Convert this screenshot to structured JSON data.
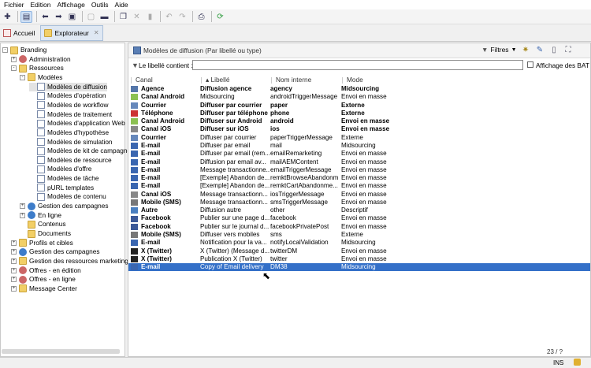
{
  "menu": [
    "Fichier",
    "Edition",
    "Affichage",
    "Outils",
    "Aide"
  ],
  "tabs": [
    {
      "label": "Accueil"
    },
    {
      "label": "Explorateur"
    }
  ],
  "tree": [
    {
      "label": "Branding",
      "level": 0,
      "exp": "-",
      "icon": "folder"
    },
    {
      "label": "Administration",
      "level": 1,
      "exp": "+",
      "icon": "gear"
    },
    {
      "label": "Ressources",
      "level": 1,
      "exp": "-",
      "icon": "folder"
    },
    {
      "label": "Modèles",
      "level": 2,
      "exp": "-",
      "icon": "folder"
    },
    {
      "label": "Modèles de diffusion",
      "level": 3,
      "exp": "",
      "icon": "doc",
      "selected": true
    },
    {
      "label": "Modèles d'opération",
      "level": 3,
      "exp": "",
      "icon": "doc"
    },
    {
      "label": "Modèles de workflow",
      "level": 3,
      "exp": "",
      "icon": "doc"
    },
    {
      "label": "Modèles de traitement",
      "level": 3,
      "exp": "",
      "icon": "doc"
    },
    {
      "label": "Modèles d'application Web",
      "level": 3,
      "exp": "",
      "icon": "doc"
    },
    {
      "label": "Modèles d'hypothèse",
      "level": 3,
      "exp": "",
      "icon": "doc"
    },
    {
      "label": "Modèles de simulation",
      "level": 3,
      "exp": "",
      "icon": "doc"
    },
    {
      "label": "Modèles de kit de campagne",
      "level": 3,
      "exp": "",
      "icon": "doc"
    },
    {
      "label": "Modèles de ressource",
      "level": 3,
      "exp": "",
      "icon": "doc"
    },
    {
      "label": "Modèles d'offre",
      "level": 3,
      "exp": "",
      "icon": "doc"
    },
    {
      "label": "Modèles de tâche",
      "level": 3,
      "exp": "",
      "icon": "doc"
    },
    {
      "label": "pURL templates",
      "level": 3,
      "exp": "",
      "icon": "doc"
    },
    {
      "label": "Modèles de contenu",
      "level": 3,
      "exp": "",
      "icon": "doc"
    },
    {
      "label": "Gestion des campagnes",
      "level": 2,
      "exp": "+",
      "icon": "globe"
    },
    {
      "label": "En ligne",
      "level": 2,
      "exp": "+",
      "icon": "globe"
    },
    {
      "label": "Contenus",
      "level": 2,
      "exp": "",
      "icon": "folder"
    },
    {
      "label": "Documents",
      "level": 2,
      "exp": "",
      "icon": "folder"
    },
    {
      "label": "Profils et cibles",
      "level": 1,
      "exp": "+",
      "icon": "folder"
    },
    {
      "label": "Gestion des campagnes",
      "level": 1,
      "exp": "+",
      "icon": "globe"
    },
    {
      "label": "Gestion des ressources marketing",
      "level": 1,
      "exp": "+",
      "icon": "folder"
    },
    {
      "label": "Offres - en édition",
      "level": 1,
      "exp": "+",
      "icon": "gear"
    },
    {
      "label": "Offres - en ligne",
      "level": 1,
      "exp": "+",
      "icon": "gear"
    },
    {
      "label": "Message Center",
      "level": 1,
      "exp": "+",
      "icon": "folder"
    }
  ],
  "right": {
    "title": "Modèles de diffusion (Par libellé ou type)",
    "filters_label": "Filtres",
    "filter_label": "Le libellé contient :",
    "filter_value": "",
    "bat_label": "Affichage des BAT",
    "columns": [
      "Canal",
      "Libellé",
      "Nom interne",
      "Mode"
    ],
    "rows": [
      {
        "canal": "Agence",
        "libelle": "Diffusion agence",
        "nom": "agency",
        "mode": "Midsourcing",
        "icon": "#5577aa",
        "bold": true
      },
      {
        "canal": "Canal Android",
        "libelle": "Midsourcing",
        "nom": "androidTriggerMessage",
        "mode": "Envoi en masse",
        "icon": "#8cc152",
        "bold": false
      },
      {
        "canal": "Courrier",
        "libelle": "Diffuser par courrier",
        "nom": "paper",
        "mode": "Externe",
        "icon": "#6688bb",
        "bold": true
      },
      {
        "canal": "Téléphone",
        "libelle": "Diffuser par téléphone",
        "nom": "phone",
        "mode": "Externe",
        "icon": "#cc3333",
        "bold": true
      },
      {
        "canal": "Canal Android",
        "libelle": "Diffuser sur Android",
        "nom": "android",
        "mode": "Envoi en masse",
        "icon": "#8cc152",
        "bold": true
      },
      {
        "canal": "Canal iOS",
        "libelle": "Diffuser sur iOS",
        "nom": "ios",
        "mode": "Envoi en masse",
        "icon": "#888888",
        "bold": true
      },
      {
        "canal": "Courrier",
        "libelle": "Diffuser par courrier",
        "nom": "paperTriggerMessage",
        "mode": "Externe",
        "icon": "#6688bb",
        "bold": false
      },
      {
        "canal": "E-mail",
        "libelle": "Diffuser par email",
        "nom": "mail",
        "mode": "Midsourcing",
        "icon": "#3a66b0",
        "bold": false
      },
      {
        "canal": "E-mail",
        "libelle": "Diffuser par email (rem...",
        "nom": "emailRemarketing",
        "mode": "Envoi en masse",
        "icon": "#3a66b0",
        "bold": false
      },
      {
        "canal": "E-mail",
        "libelle": "Diffusion par email av...",
        "nom": "mailAEMContent",
        "mode": "Envoi en masse",
        "icon": "#3a66b0",
        "bold": false
      },
      {
        "canal": "E-mail",
        "libelle": "Message transactionne...",
        "nom": "emailTriggerMessage",
        "mode": "Envoi en masse",
        "icon": "#3a66b0",
        "bold": false
      },
      {
        "canal": "E-mail",
        "libelle": "[Exemple] Abandon de...",
        "nom": "remktBrowseAbandonm",
        "mode": "Envoi en masse",
        "icon": "#3a66b0",
        "bold": false
      },
      {
        "canal": "E-mail",
        "libelle": "[Exemple] Abandon de...",
        "nom": "remktCartAbandonme...",
        "mode": "Envoi en masse",
        "icon": "#3a66b0",
        "bold": false
      },
      {
        "canal": "Canal iOS",
        "libelle": "Message transactionn...",
        "nom": "iosTriggerMessage",
        "mode": "Envoi en masse",
        "icon": "#888888",
        "bold": false
      },
      {
        "canal": "Mobile (SMS)",
        "libelle": "Message transactionn...",
        "nom": "smsTriggerMessage",
        "mode": "Envoi en masse",
        "icon": "#777777",
        "bold": false
      },
      {
        "canal": "Autre",
        "libelle": "Diffusion autre",
        "nom": "other",
        "mode": "Descriptif",
        "icon": "#4a7fc0",
        "bold": false
      },
      {
        "canal": "Facebook",
        "libelle": "Publier sur une page d...",
        "nom": "facebook",
        "mode": "Envoi en masse",
        "icon": "#3b5998",
        "bold": false
      },
      {
        "canal": "Facebook",
        "libelle": "Publier sur le journal d...",
        "nom": "facebookPrivatePost",
        "mode": "Envoi en masse",
        "icon": "#3b5998",
        "bold": false
      },
      {
        "canal": "Mobile (SMS)",
        "libelle": "Diffuser vers mobiles",
        "nom": "sms",
        "mode": "Externe",
        "icon": "#777777",
        "bold": false
      },
      {
        "canal": "E-mail",
        "libelle": "Notification pour la va...",
        "nom": "notifyLocalValidation",
        "mode": "Midsourcing",
        "icon": "#3a66b0",
        "bold": false
      },
      {
        "canal": "X (Twitter)",
        "libelle": "X (Twitter) (Message d...",
        "nom": "twitterDM",
        "mode": "Envoi en masse",
        "icon": "#222222",
        "bold": false
      },
      {
        "canal": "X (Twitter)",
        "libelle": "Publication X (Twitter)",
        "nom": "twitter",
        "mode": "Envoi en masse",
        "icon": "#222222",
        "bold": false
      },
      {
        "canal": "E-mail",
        "libelle": "Copy of Email delivery",
        "nom": "DM38",
        "mode": "Midsourcing",
        "icon": "#3a66b0",
        "bold": false,
        "selected": true
      }
    ]
  },
  "status": {
    "count": "23 / ?",
    "ins": "INS"
  }
}
